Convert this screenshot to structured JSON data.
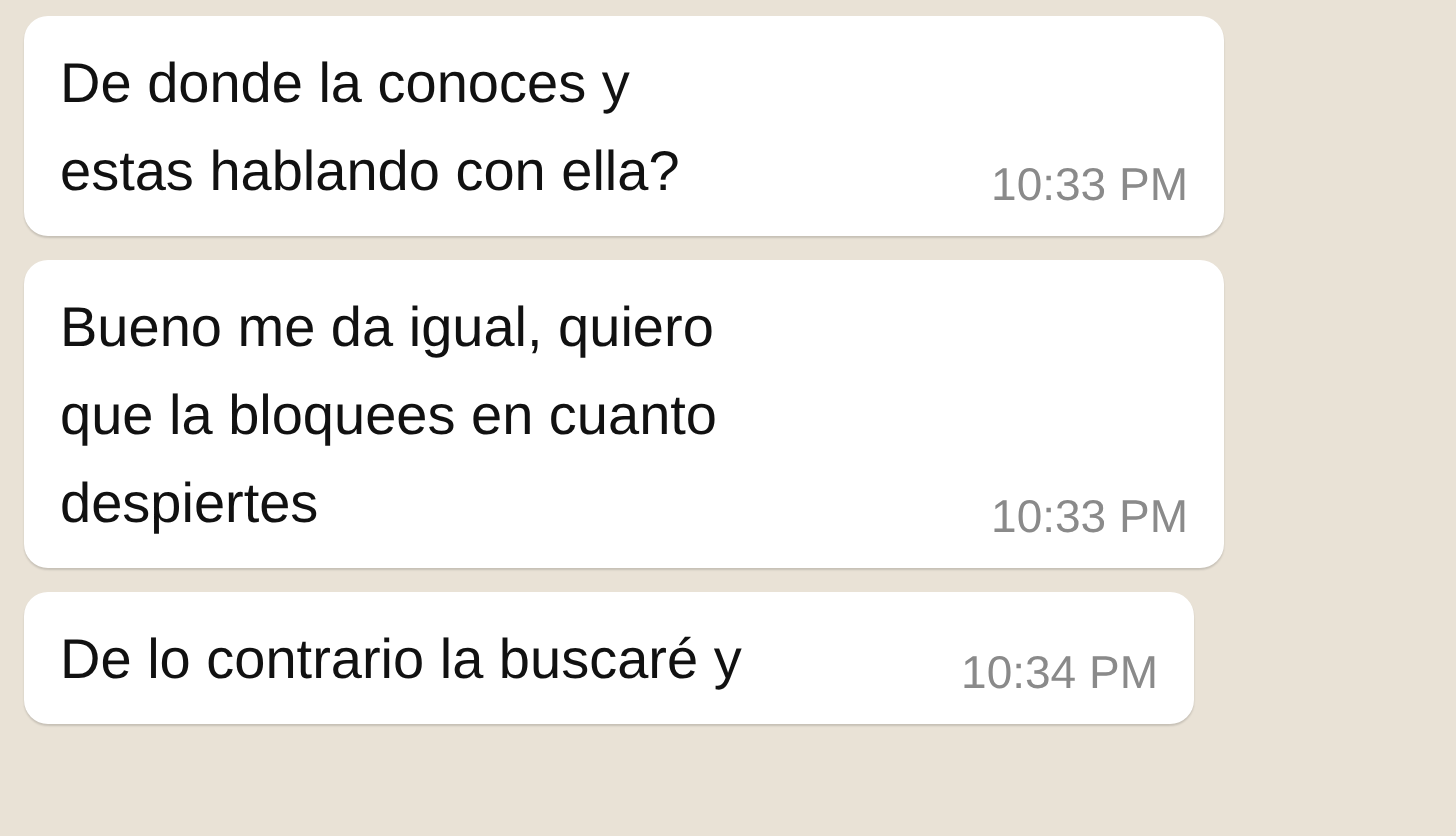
{
  "messages": [
    {
      "lines": [
        "De donde la conoces y",
        "estas hablando con ella?"
      ],
      "time": "10:33 PM"
    },
    {
      "lines": [
        "Bueno me da igual, quiero",
        "que la bloquees en cuanto",
        "despiertes"
      ],
      "time": "10:33 PM"
    },
    {
      "lines": [
        "De lo contrario la buscaré y"
      ],
      "time": "10:34 PM"
    }
  ]
}
